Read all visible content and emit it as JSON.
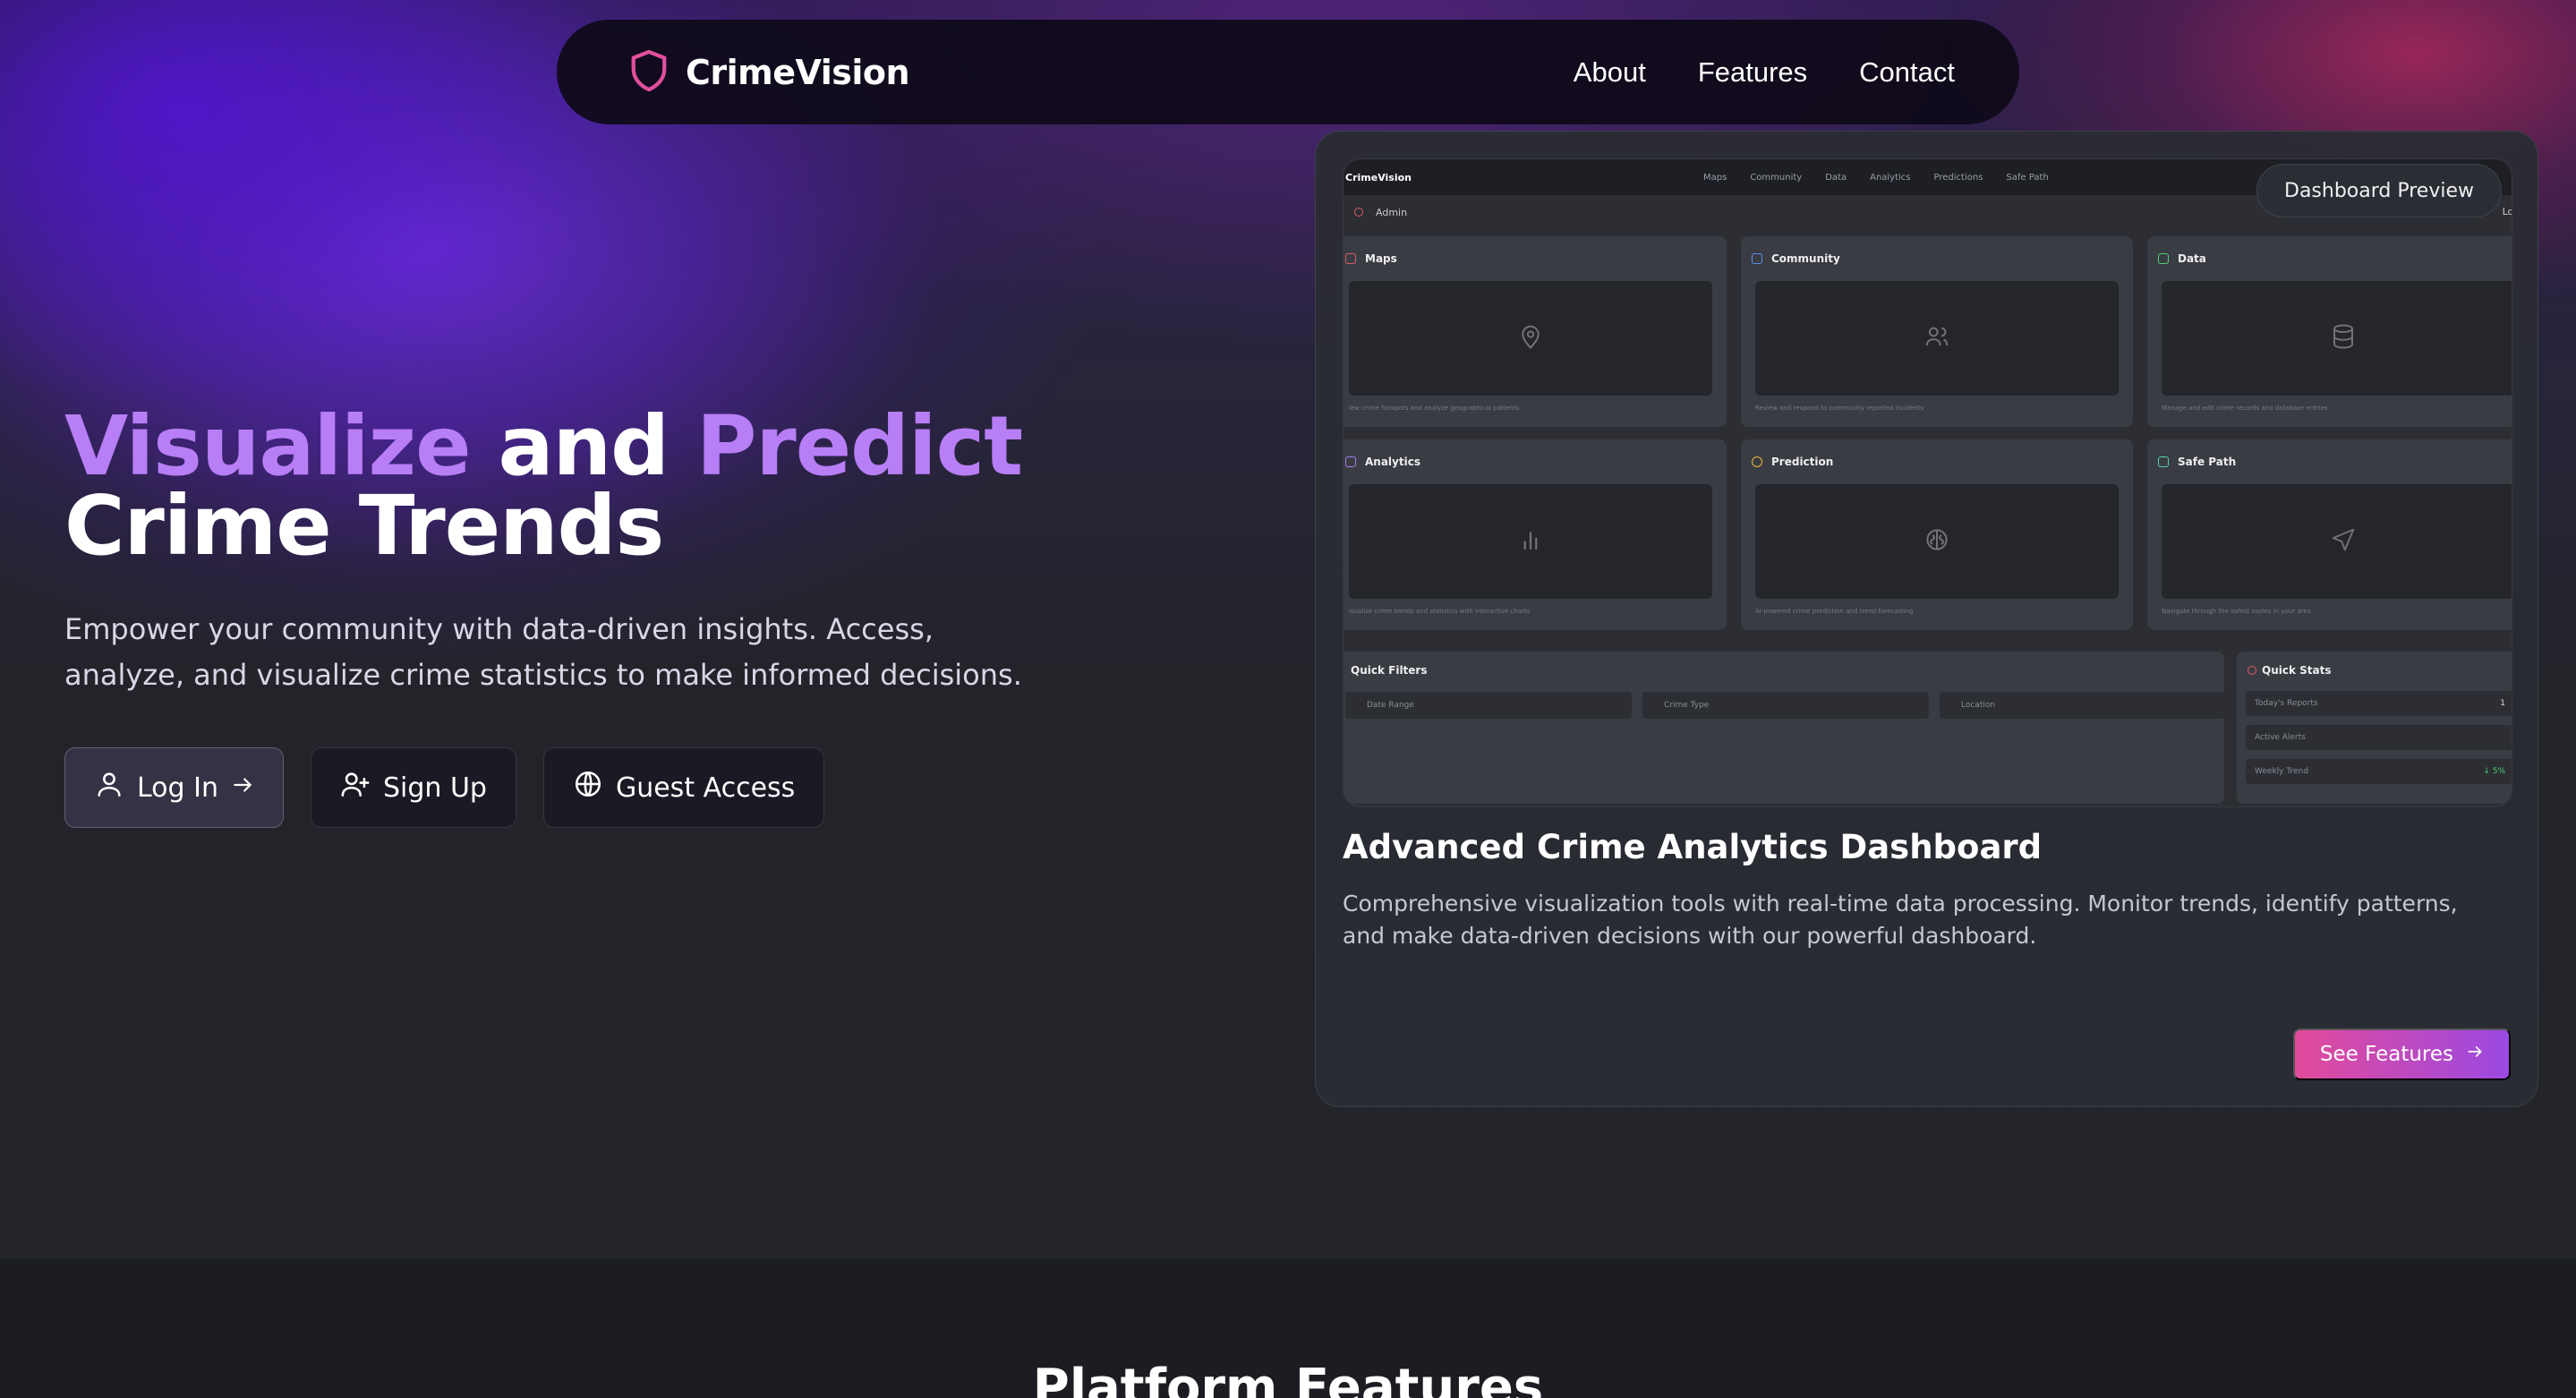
{
  "brand": {
    "name": "CrimeVision",
    "accent": "#e34f9c"
  },
  "nav": {
    "links": [
      "About",
      "Features",
      "Contact"
    ]
  },
  "hero": {
    "title_word1": "Visualize",
    "title_word2": "and",
    "title_word3": "Predict",
    "title_line2": "Crime Trends",
    "subtitle": "Empower your community with data-driven insights. Access, analyze, and visualize crime statistics to make informed decisions.",
    "buttons": {
      "login": "Log In",
      "signup": "Sign Up",
      "guest": "Guest Access"
    }
  },
  "dashboard_card": {
    "badge": "Dashboard Preview",
    "title": "Advanced Crime Analytics Dashboard",
    "description": "Comprehensive visualization tools with real-time data processing. Monitor trends, identify patterns, and make data-driven decisions with our powerful dashboard.",
    "cta": "See Features"
  },
  "preview": {
    "brand": "CrimeVision",
    "nav": [
      "Maps",
      "Community",
      "Data",
      "Analytics",
      "Predictions",
      "Safe Path"
    ],
    "user": "Admin",
    "logout": "Logo",
    "tiles": [
      {
        "title": "Maps",
        "desc": "iew crime hotspots and analyze geographical patterns",
        "color": "#e05a67",
        "icon": "map-pin-icon"
      },
      {
        "title": "Community",
        "desc": "Review and respond to community reported incidents",
        "color": "#5b8def",
        "icon": "users-icon"
      },
      {
        "title": "Data",
        "desc": "Manage and edit crime records and database entries",
        "color": "#4ccf77",
        "icon": "database-icon"
      },
      {
        "title": "Analytics",
        "desc": "isualize crime trends and statistics with interactive charts",
        "color": "#a67cf0",
        "icon": "bar-chart-icon"
      },
      {
        "title": "Prediction",
        "desc": "AI-powered crime prediction and trend forecasting",
        "color": "#e8b83a",
        "icon": "brain-icon"
      },
      {
        "title": "Safe Path",
        "desc": "Navigate through the safest routes in your area",
        "color": "#4fd1a5",
        "icon": "navigation-icon"
      }
    ],
    "filters": {
      "title": "Quick Filters",
      "inputs": [
        "Date Range",
        "Crime Type",
        "Location"
      ]
    },
    "stats": {
      "title": "Quick Stats",
      "rows": [
        {
          "label": "Today's Reports",
          "value": "1"
        },
        {
          "label": "Active Alerts",
          "value": ""
        },
        {
          "label": "Weekly Trend",
          "value": "↓ 5%"
        }
      ]
    }
  },
  "features_section": {
    "title": "Platform Features"
  }
}
